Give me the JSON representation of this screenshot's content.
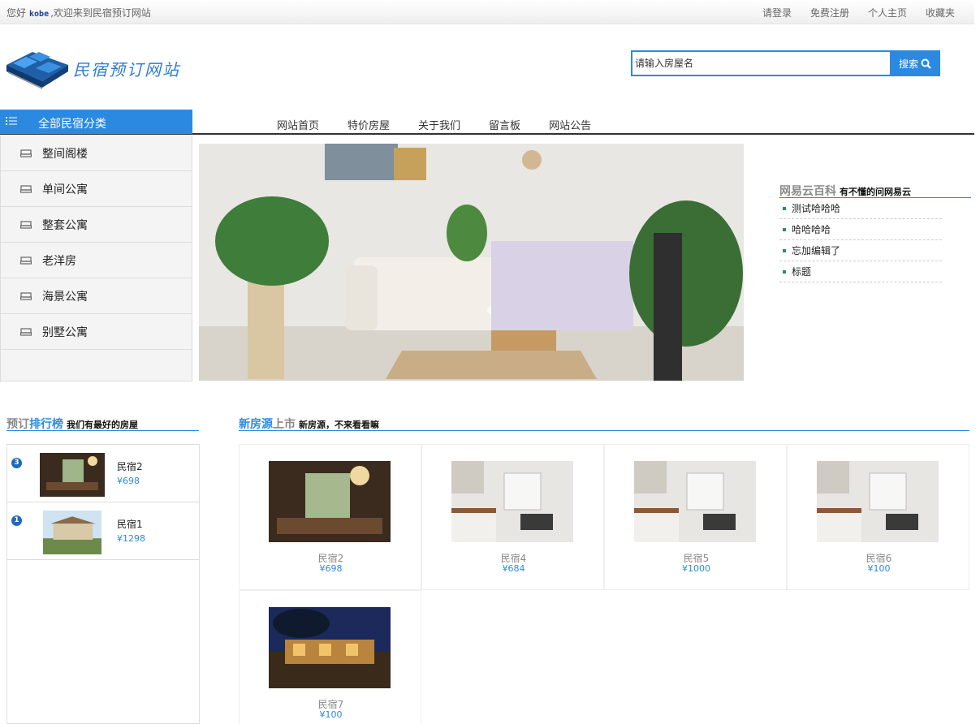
{
  "topbar": {
    "greeting_prefix": "您好",
    "username": "kobe",
    "greeting_suffix": ",欢迎来到民宿预订网站",
    "links": [
      "请登录",
      "免费注册",
      "个人主页",
      "收藏夹"
    ]
  },
  "header": {
    "site_name": "民宿预订网站",
    "search_placeholder": "请输入房屋名",
    "search_button": "搜索"
  },
  "nav": {
    "category_title": "全部民宿分类",
    "links": [
      "网站首页",
      "特价房屋",
      "关于我们",
      "留言板",
      "网站公告"
    ]
  },
  "categories": [
    "整间阁楼",
    "单间公寓",
    "整套公寓",
    "老洋房",
    "海景公寓",
    "别墅公寓"
  ],
  "wiki": {
    "title": "网易云百科",
    "subtitle": "有不懂的问网易云",
    "items": [
      "测试哈哈哈",
      "哈哈哈哈",
      "忘加编辑了",
      "标题"
    ]
  },
  "ranking": {
    "title_a": "预订",
    "title_b": "排行榜",
    "subtitle": "我们有最好的房屋",
    "items": [
      {
        "rank": "3",
        "name": "民宿2",
        "price": "¥698"
      },
      {
        "rank": "1",
        "name": "民宿1",
        "price": "¥1298"
      }
    ]
  },
  "new_listings": {
    "title_a": "新房源",
    "title_b": "上市",
    "subtitle": "新房源，不来看看嘛",
    "items": [
      {
        "name": "民宿2",
        "price": "¥698"
      },
      {
        "name": "民宿4",
        "price": "¥684"
      },
      {
        "name": "民宿5",
        "price": "¥1000"
      },
      {
        "name": "民宿6",
        "price": "¥100"
      },
      {
        "name": "民宿7",
        "price": "¥100"
      }
    ]
  },
  "colors": {
    "accent": "#2b8ae0",
    "nav_line": "#333333"
  }
}
